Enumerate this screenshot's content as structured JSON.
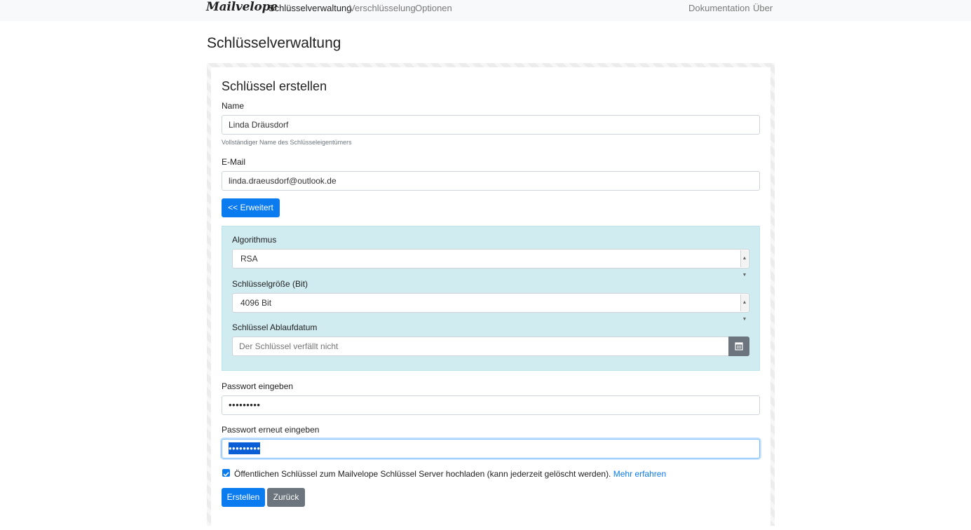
{
  "nav": {
    "brand": "Mailvelope",
    "links": [
      "Schlüsselverwaltung",
      "Verschlüsselung",
      "Optionen"
    ],
    "right_links": [
      "Dokumentation",
      "Über"
    ]
  },
  "page_title": "Schlüsselverwaltung",
  "form": {
    "title": "Schlüssel erstellen",
    "name_label": "Name",
    "name_value": "Linda Dräusdorf",
    "name_help": "Vollständiger Name des Schlüsseleigentümers",
    "email_label": "E-Mail",
    "email_value": "linda.draeusdorf@outlook.de",
    "advanced_button": "<< Erweitert",
    "advanced": {
      "algorithm_label": "Algorithmus",
      "algorithm_value": "RSA",
      "keysize_label": "Schlüsselgröße (Bit)",
      "keysize_value": "4096 Bit",
      "expiry_label": "Schlüssel Ablaufdatum",
      "expiry_placeholder": "Der Schlüssel verfällt nicht"
    },
    "password_label": "Passwort eingeben",
    "password_value": "•••••••••",
    "password_repeat_label": "Passwort erneut eingeben",
    "password_repeat_value": "•••••••••",
    "upload_checkbox_text": "Öffentlichen Schlüssel zum Mailvelope Schlüssel Server hochladen (kann jederzeit gelöscht werden).",
    "upload_link": "Mehr erfahren",
    "submit_button": "Erstellen",
    "back_button": "Zurück"
  },
  "colors": {
    "primary": "#0b7bf0",
    "secondary": "#6c757d",
    "advanced_panel": "#d1ecf1",
    "navbar": "#f8f9fa"
  },
  "icons": [
    "calendar-icon",
    "check-icon",
    "chevron-updown-icon"
  ]
}
